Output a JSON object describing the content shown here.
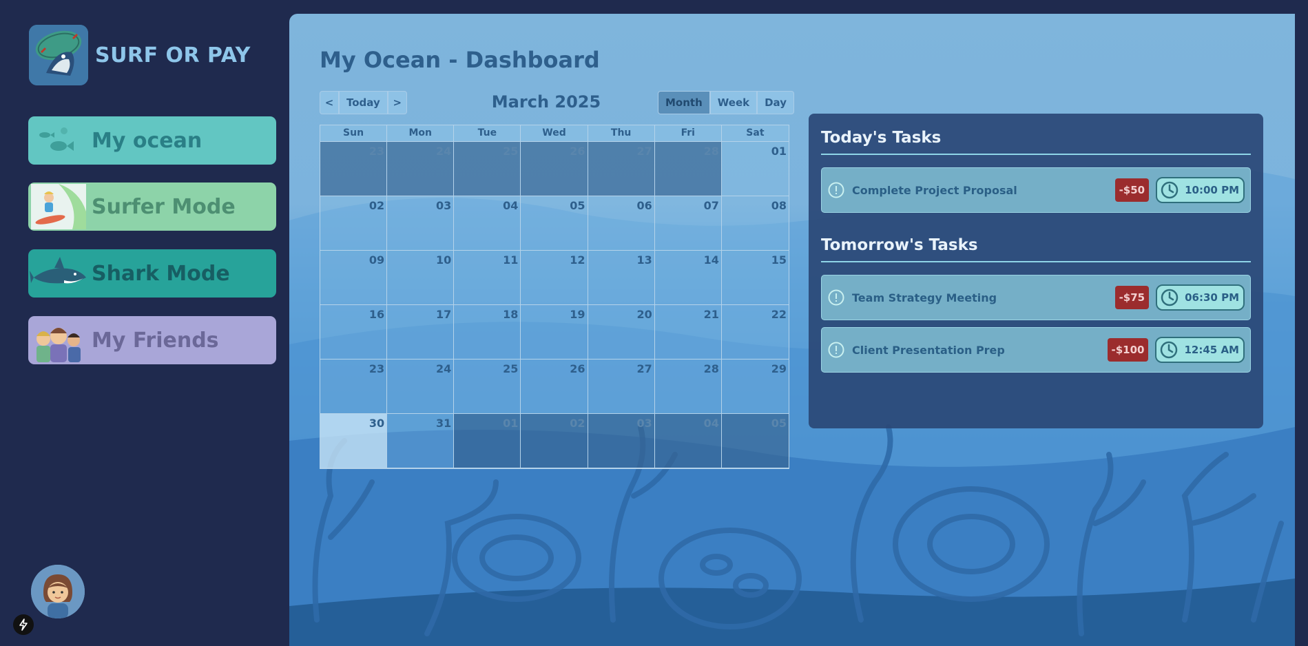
{
  "app": {
    "name": "SURF OR PAY"
  },
  "nav": [
    {
      "label": "My ocean"
    },
    {
      "label": "Surfer Mode"
    },
    {
      "label": "Shark Mode"
    },
    {
      "label": "My Friends"
    }
  ],
  "page": {
    "title": "My Ocean - Dashboard"
  },
  "calendar": {
    "prev_label": "<",
    "today_label": "Today",
    "next_label": ">",
    "title": "March 2025",
    "views": [
      "Month",
      "Week",
      "Day"
    ],
    "active_view": "Month",
    "weekdays": [
      "Sun",
      "Mon",
      "Tue",
      "Wed",
      "Thu",
      "Fri",
      "Sat"
    ],
    "days": [
      {
        "d": "23",
        "other": true
      },
      {
        "d": "24",
        "other": true
      },
      {
        "d": "25",
        "other": true
      },
      {
        "d": "26",
        "other": true
      },
      {
        "d": "27",
        "other": true
      },
      {
        "d": "28",
        "other": true
      },
      {
        "d": "01"
      },
      {
        "d": "02"
      },
      {
        "d": "03"
      },
      {
        "d": "04"
      },
      {
        "d": "05"
      },
      {
        "d": "06"
      },
      {
        "d": "07"
      },
      {
        "d": "08"
      },
      {
        "d": "09"
      },
      {
        "d": "10"
      },
      {
        "d": "11"
      },
      {
        "d": "12"
      },
      {
        "d": "13"
      },
      {
        "d": "14"
      },
      {
        "d": "15"
      },
      {
        "d": "16"
      },
      {
        "d": "17"
      },
      {
        "d": "18"
      },
      {
        "d": "19"
      },
      {
        "d": "20"
      },
      {
        "d": "21"
      },
      {
        "d": "22"
      },
      {
        "d": "23"
      },
      {
        "d": "24"
      },
      {
        "d": "25"
      },
      {
        "d": "26"
      },
      {
        "d": "27"
      },
      {
        "d": "28"
      },
      {
        "d": "29"
      },
      {
        "d": "30",
        "today": true
      },
      {
        "d": "31"
      },
      {
        "d": "01",
        "other": true
      },
      {
        "d": "02",
        "other": true
      },
      {
        "d": "03",
        "other": true
      },
      {
        "d": "04",
        "other": true
      },
      {
        "d": "05",
        "other": true
      }
    ]
  },
  "tasks": {
    "today_title": "Today's Tasks",
    "tomorrow_title": "Tomorrow's Tasks",
    "today": [
      {
        "name": "Complete Project Proposal",
        "penalty": "-$50",
        "time": "10:00 PM"
      }
    ],
    "tomorrow": [
      {
        "name": "Team Strategy Meeting",
        "penalty": "-$75",
        "time": "06:30 PM"
      },
      {
        "name": "Client Presentation Prep",
        "penalty": "-$100",
        "time": "12:45 AM"
      }
    ]
  },
  "colors": {
    "sidebar_bg": "#1f2a4e",
    "accent_text": "#2e5f8c",
    "penalty_red": "#9b2c2d",
    "time_badge": "#9fe2e2"
  }
}
